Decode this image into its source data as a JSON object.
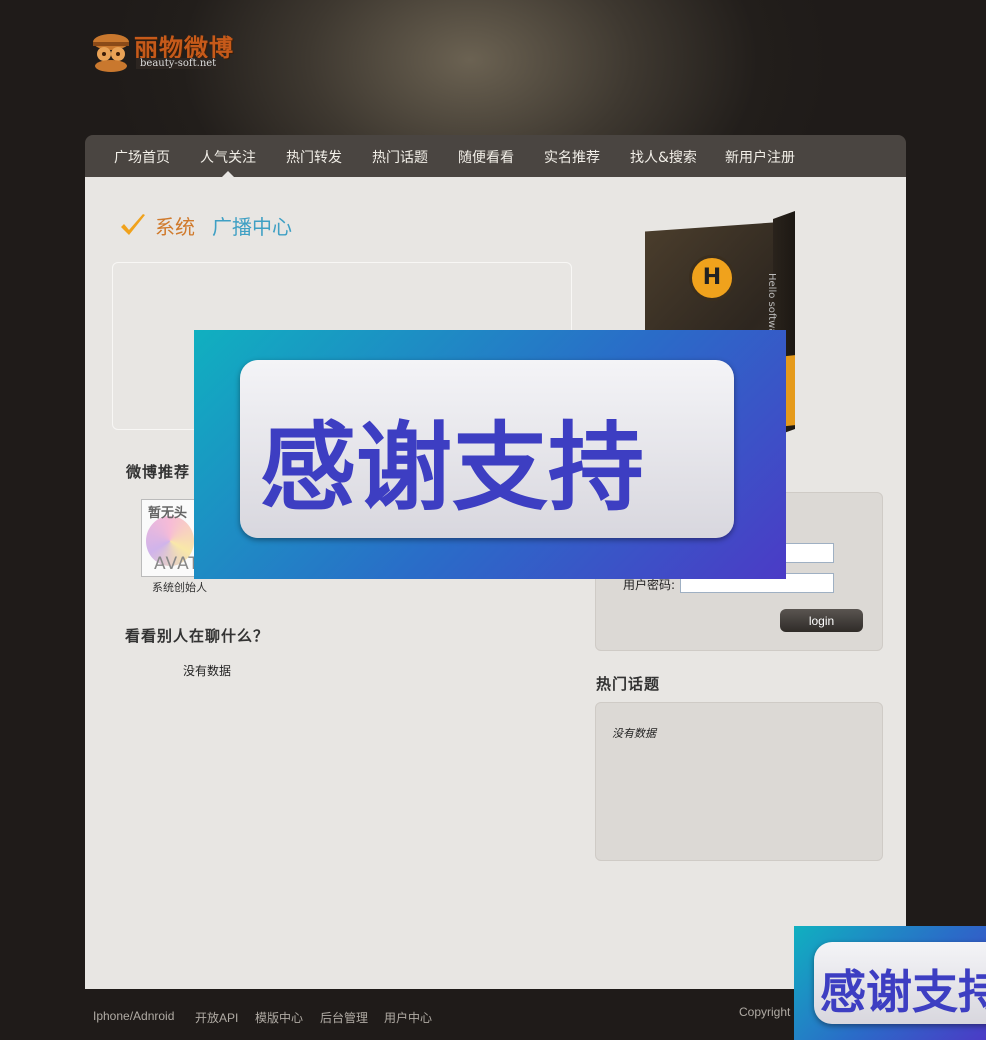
{
  "header": {
    "logo_text": "丽物微博",
    "logo_sub": "beauty-soft.net"
  },
  "nav": {
    "items": [
      "广场首页",
      "人气关注",
      "热门转发",
      "热门话题",
      "随便看看",
      "实名推荐",
      "找人&搜索",
      "新用户注册"
    ]
  },
  "main": {
    "title_part1": "系统",
    "title_part2": "广播中心",
    "recommend_heading": "微博推荐",
    "avatar_top": "暂无头",
    "avatar_bottom": "AVAT",
    "avatar_name": "系统创始人",
    "chat_heading": "看看别人在聊什么？",
    "chat_empty": "没有数据"
  },
  "product": {
    "letter": "H",
    "side_text": "Hello software"
  },
  "login": {
    "password_label": "用户密码:",
    "button": "login"
  },
  "topics": {
    "heading": "热门话题",
    "empty": "没有数据"
  },
  "footer": {
    "links": [
      "Iphone/Adnroid",
      "开放API",
      "模版中心",
      "后台管理",
      "用户中心"
    ],
    "copyright": "Copyright"
  },
  "overlay": {
    "text": "感谢支持",
    "text_partial": "感谢支持"
  }
}
